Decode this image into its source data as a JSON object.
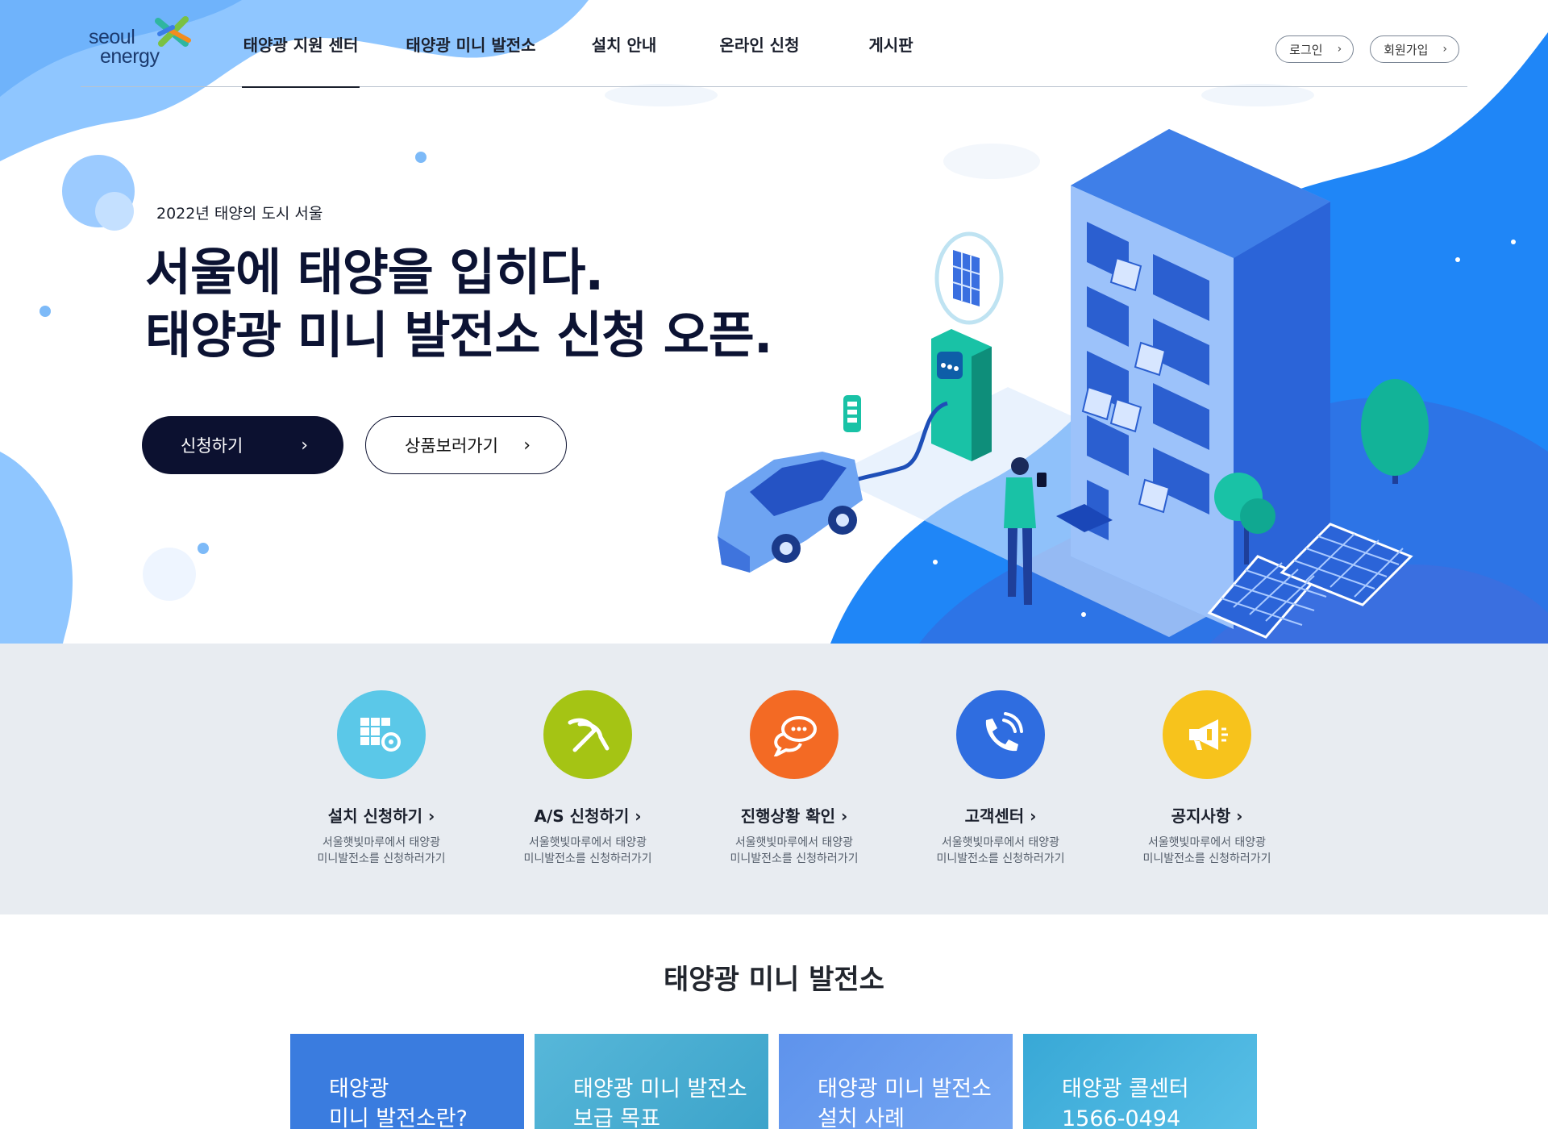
{
  "brand": {
    "logo_line1": "seoul",
    "logo_line2": "energy"
  },
  "nav": {
    "items": [
      {
        "label": "태양광 지원 센터",
        "active": true
      },
      {
        "label": "태양광 미니 발전소",
        "active": false
      },
      {
        "label": "설치 안내",
        "active": false
      },
      {
        "label": "온라인 신청",
        "active": false
      },
      {
        "label": "게시판",
        "active": false
      }
    ]
  },
  "auth": {
    "login": "로그인",
    "signup": "회원가입"
  },
  "hero": {
    "eyebrow": "2022년 태양의 도시 서울",
    "headline_line1": "서울에 태양을 입히다.",
    "headline_line2": "태양광 미니 발전소 신청 오픈.",
    "primary_cta": "신청하기",
    "secondary_cta": "상품보러가기"
  },
  "quick_menu": [
    {
      "title": "설치 신청하기 ›",
      "desc": "서울햇빛마루에서 태양광\n미니발전소를 신청하러가기",
      "color": "#5bc8e8",
      "icon": "solar-panel-gear-icon"
    },
    {
      "title": "A/S 신청하기 ›",
      "desc": "서울햇빛마루에서 태양광\n미니발전소를 신청하러가기",
      "color": "#a5c414",
      "icon": "pliers-icon"
    },
    {
      "title": "진행상황 확인 ›",
      "desc": "서울햇빛마루에서 태양광\n미니발전소를 신청하러가기",
      "color": "#f36a24",
      "icon": "chat-bubbles-icon"
    },
    {
      "title": "고객센터 ›",
      "desc": "서울햇빛마루에서 태양광\n미니발전소를 신청하러가기",
      "color": "#2f6de0",
      "icon": "phone-call-icon"
    },
    {
      "title": "공지사항 ›",
      "desc": "서울햇빛마루에서 태양광\n미니발전소를 신청하러가기",
      "color": "#f7c31c",
      "icon": "megaphone-icon"
    }
  ],
  "section": {
    "title": "태양광 미니 발전소",
    "cards": [
      {
        "line1": "태양광",
        "line2": "미니 발전소란?"
      },
      {
        "line1": "태양광 미니 발전소",
        "line2": "보급 목표"
      },
      {
        "line1": "태양광 미니 발전소",
        "line2": "설치 사례"
      },
      {
        "line1": "태양광 콜센터",
        "line2": "1566-0494"
      }
    ]
  }
}
